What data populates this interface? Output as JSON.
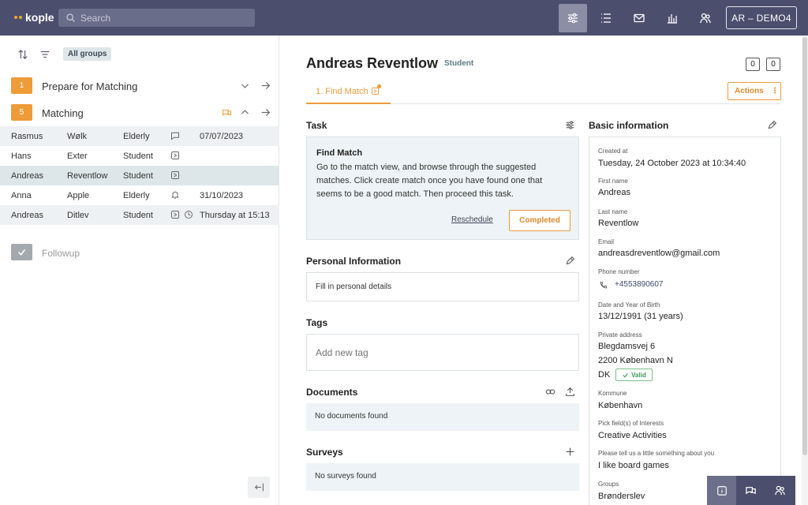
{
  "brand": {
    "name": "kople",
    "accent": "#ee9b3a",
    "topbar_bg": "#4b4e6d"
  },
  "search": {
    "placeholder": "Search"
  },
  "topnav": [
    "tasks-icon",
    "list-icon",
    "mail-icon",
    "chart-icon",
    "people-icon"
  ],
  "user": {
    "label": "AR – DEMO4"
  },
  "sidebar": {
    "filter_chip": "All groups",
    "groups": [
      {
        "count": "1",
        "name": "Prepare for Matching"
      },
      {
        "count": "5",
        "name": "Matching"
      }
    ],
    "rows": [
      {
        "first": "Rasmus",
        "last": "Wølk",
        "type": "Elderly",
        "date": "07/07/2023"
      },
      {
        "first": "Hans",
        "last": "Exter",
        "type": "Student",
        "date": ""
      },
      {
        "first": "Andreas",
        "last": "Reventlow",
        "type": "Student",
        "date": ""
      },
      {
        "first": "Anna",
        "last": "Apple",
        "type": "Elderly",
        "date": "31/10/2023"
      },
      {
        "first": "Andreas",
        "last": "Ditlev",
        "type": "Student",
        "date": "Thursday at 15:13"
      }
    ],
    "followup": "Followup"
  },
  "profile": {
    "name": "Andreas Reventlow",
    "type": "Student",
    "counters": [
      "0",
      "0"
    ],
    "tab": "1.  Find Match",
    "actions": "Actions"
  },
  "task": {
    "section": "Task",
    "title": "Find Match",
    "description": "Go to the match view, and browse through the suggested matches. Click create match once you have found one that seems to be a good match. Then proceed this task.",
    "reschedule": "Reschedule",
    "completed": "Completed"
  },
  "personal": {
    "section": "Personal Information",
    "text": "Fill in personal details"
  },
  "tags": {
    "section": "Tags",
    "placeholder": "Add new tag"
  },
  "documents": {
    "section": "Documents",
    "empty": "No documents found"
  },
  "surveys": {
    "section": "Surveys",
    "empty": "No surveys found"
  },
  "basic": {
    "section": "Basic information",
    "created_label": "Created at",
    "created": "Tuesday, 24 October 2023 at 10:34:40",
    "first_label": "First name",
    "first": "Andreas",
    "last_label": "Last name",
    "last": "Reventlow",
    "email_label": "Email",
    "email": "andreasdreventlow@gmail.com",
    "phone_label": "Phone number",
    "phone": "+4553890607",
    "dob_label": "Date and Year of Birth",
    "dob": "13/12/1991 (31 years)",
    "address_label": "Private address",
    "address1": "Blegdamsvej 6",
    "address2": "2200 København N",
    "country": "DK",
    "valid": "Valid",
    "kommune_label": "Kommune",
    "kommune": "København",
    "interests_label": "Pick field(s) of Interests",
    "interests": "Creative Activities",
    "about_label": "Please tell us a little something about you",
    "about": "I like board games",
    "groups_label": "Groups",
    "groups": "Brønderslev"
  }
}
